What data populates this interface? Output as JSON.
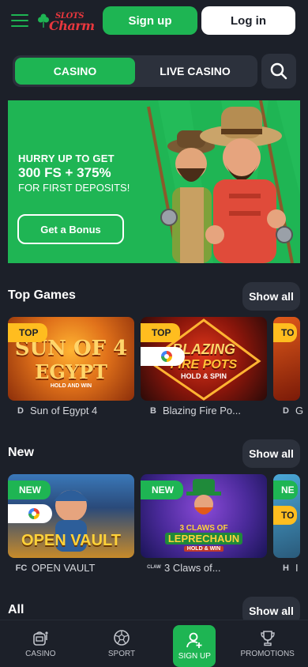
{
  "header": {
    "logo_top": "SLOTS",
    "logo_bottom": "Charm",
    "signup_label": "Sign up",
    "login_label": "Log in"
  },
  "tabs": [
    {
      "label": "CASINO",
      "active": true
    },
    {
      "label": "LIVE CASINO",
      "active": false
    }
  ],
  "banner": {
    "line1": "HURRY UP TO GET",
    "line2": "300 FS + 375%",
    "line3": "FOR FIRST DEPOSITS!",
    "button_label": "Get a Bonus"
  },
  "sections": {
    "top_games": {
      "title": "Top Games",
      "show_all": "Show all",
      "cards": [
        {
          "badge": "TOP",
          "art_line1": "SUN OF 4",
          "art_line2": "EGYPT",
          "art_line3": "HOLD AND WIN",
          "title": "Sun of Egypt 4",
          "provider_icon": "D"
        },
        {
          "badge": "TOP",
          "art_line1": "BLAZING",
          "art_line2": "FIRE POTS",
          "art_line3": "HOLD & SPIN",
          "title": "Blazing Fire Po...",
          "provider_icon": "B"
        },
        {
          "badge": "TO",
          "title": "G",
          "provider_icon": "D"
        }
      ]
    },
    "new": {
      "title": "New",
      "show_all": "Show all",
      "cards": [
        {
          "badge": "NEW",
          "art_line1": "OPEN VAULT",
          "title": "OPEN VAULT",
          "provider_icon": "FC"
        },
        {
          "badge": "NEW",
          "art_line1": "3 CLAWS OF",
          "art_line2": "LEPRECHAUN",
          "art_line3": "HOLD & WIN",
          "title": "3 Claws of...",
          "provider_icon": "CLAW"
        },
        {
          "badge": "NE",
          "badge2": "TO",
          "title": "I",
          "provider_icon": "H"
        }
      ]
    },
    "all": {
      "title": "All",
      "show_all": "Show all"
    }
  },
  "bottom_nav": [
    {
      "label": "CASINO",
      "icon": "slot-machine-icon"
    },
    {
      "label": "SPORT",
      "icon": "soccer-ball-icon"
    },
    {
      "label": "SIGN UP",
      "icon": "add-user-icon",
      "active": true
    },
    {
      "label": "PROMOTIONS",
      "icon": "trophy-icon"
    }
  ],
  "colors": {
    "background": "#1c2029",
    "accent_green": "#1eb553",
    "panel": "#2c313c",
    "badge_top": "#ffbd1f"
  }
}
